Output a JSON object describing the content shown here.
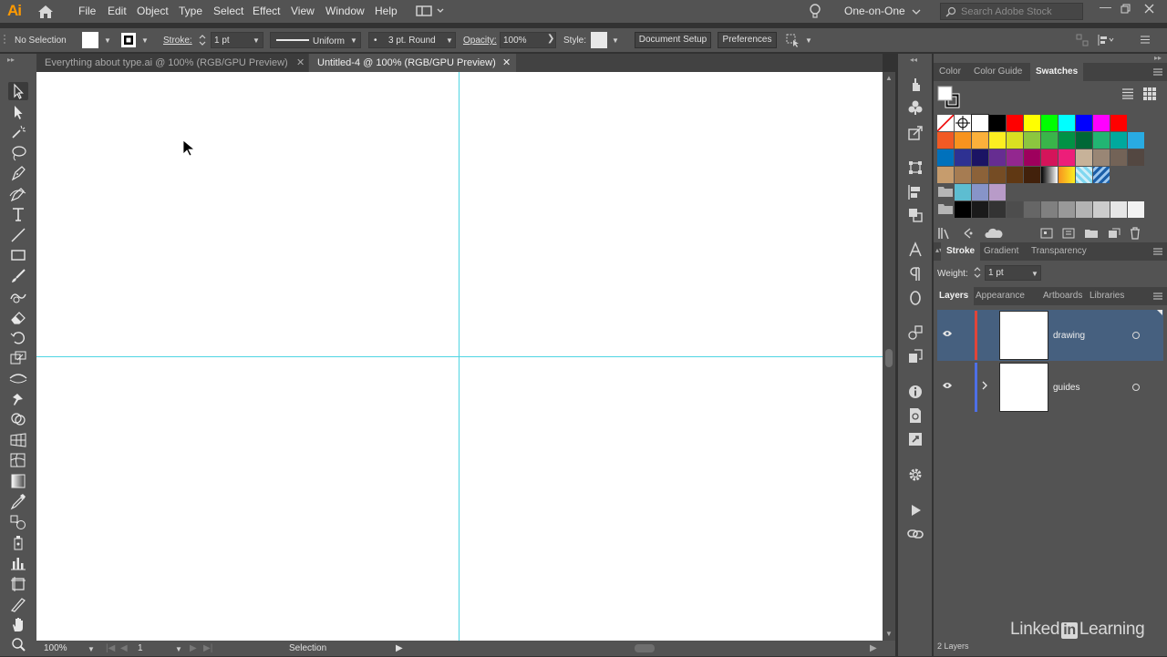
{
  "app": {
    "logo": "Ai"
  },
  "menubar": {
    "items": [
      "File",
      "Edit",
      "Object",
      "Type",
      "Select",
      "Effect",
      "View",
      "Window",
      "Help"
    ],
    "workspace": "One-on-One",
    "search_placeholder": "Search Adobe Stock"
  },
  "control": {
    "selection": "No Selection",
    "stroke_label": "Stroke:",
    "stroke_weight": "1 pt",
    "profile": "Uniform",
    "brush": "3 pt. Round",
    "opacity_label": "Opacity:",
    "opacity": "100%",
    "style_label": "Style:",
    "document_setup": "Document Setup",
    "preferences": "Preferences"
  },
  "tabs": [
    {
      "label": "Everything about type.ai @ 100% (RGB/GPU Preview)",
      "active": false
    },
    {
      "label": "Untitled-4 @ 100% (RGB/GPU Preview)",
      "active": true
    }
  ],
  "status": {
    "zoom": "100%",
    "artboard": "1",
    "tool": "Selection"
  },
  "panels": {
    "top_tabs": [
      "Color",
      "Color Guide",
      "Swatches"
    ],
    "mid_tabs": [
      "Stroke",
      "Gradient",
      "Transparency"
    ],
    "weight_label": "Weight:",
    "weight_value": "1 pt",
    "bottom_tabs": [
      "Layers",
      "Appearance",
      "Artboards",
      "Libraries"
    ],
    "layers": [
      {
        "name": "drawing",
        "color": "#e0453a",
        "selected": true
      },
      {
        "name": "guides",
        "color": "#4d6fe6",
        "selected": false
      }
    ],
    "layers_count": "2 Layers"
  },
  "swatches": {
    "row1": [
      "#000000",
      "#ff0000",
      "#ffff00",
      "#00ff00",
      "#00ffff",
      "#0000ff",
      "#ff00ff",
      "#ff0000"
    ],
    "row2": [
      "#f15a24",
      "#f7931e",
      "#fbb03b",
      "#fcee21",
      "#d9e021",
      "#8cc63f",
      "#39b54a",
      "#009245",
      "#006837",
      "#22b573",
      "#00a99d",
      "#29abe2"
    ],
    "row3": [
      "#0071bc",
      "#2e3192",
      "#1b1464",
      "#662d91",
      "#93278f",
      "#9e005d",
      "#d4145a",
      "#ed1e79",
      "#c7b299",
      "#998675",
      "#736357",
      "#534741"
    ],
    "row4": [
      "#c69c6d",
      "#a67c52",
      "#8c6239",
      "#754c24",
      "#603813",
      "#42210b"
    ],
    "row5": [
      "#5dbdd1",
      "#8794c8",
      "#b89bc8"
    ],
    "row6": [
      "#000000",
      "#1a1a1a",
      "#333333",
      "#4d4d4d",
      "#666666",
      "#808080",
      "#999999",
      "#b3b3b3",
      "#cccccc",
      "#e6e6e6",
      "#f2f2f2"
    ]
  },
  "watermark": {
    "text1": "Linked",
    "badge": "in",
    "text2": "Learning"
  }
}
